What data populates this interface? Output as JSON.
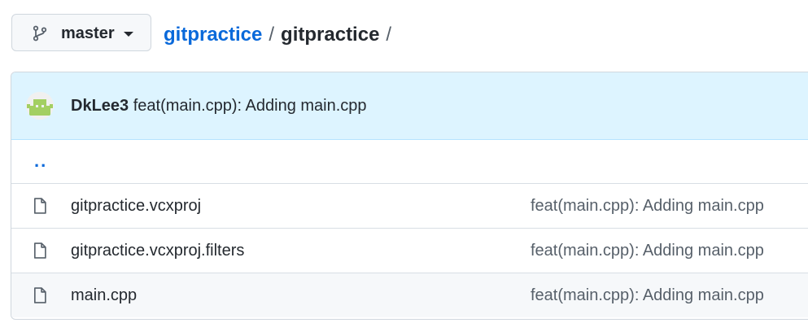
{
  "branch": {
    "name": "master",
    "icon": "git-branch-icon"
  },
  "breadcrumb": {
    "repo_link": "gitpractice",
    "separator": "/",
    "current": "gitpractice",
    "trailing_separator": "/"
  },
  "latest_commit": {
    "author": "DkLee3",
    "message": "feat(main.cpp): Adding main.cpp",
    "avatar": "avatar-icon"
  },
  "parent_dir": {
    "label": ".."
  },
  "files": [
    {
      "name": "gitpractice.vcxproj",
      "commit_message": "feat(main.cpp): Adding main.cpp",
      "icon": "file-icon"
    },
    {
      "name": "gitpractice.vcxproj.filters",
      "commit_message": "feat(main.cpp): Adding main.cpp",
      "icon": "file-icon"
    },
    {
      "name": "main.cpp",
      "commit_message": "feat(main.cpp): Adding main.cpp",
      "icon": "file-icon"
    }
  ],
  "colors": {
    "link": "#0969da",
    "commit_bg": "#ddf4ff",
    "border": "#d0d7de",
    "muted": "#57606a"
  }
}
